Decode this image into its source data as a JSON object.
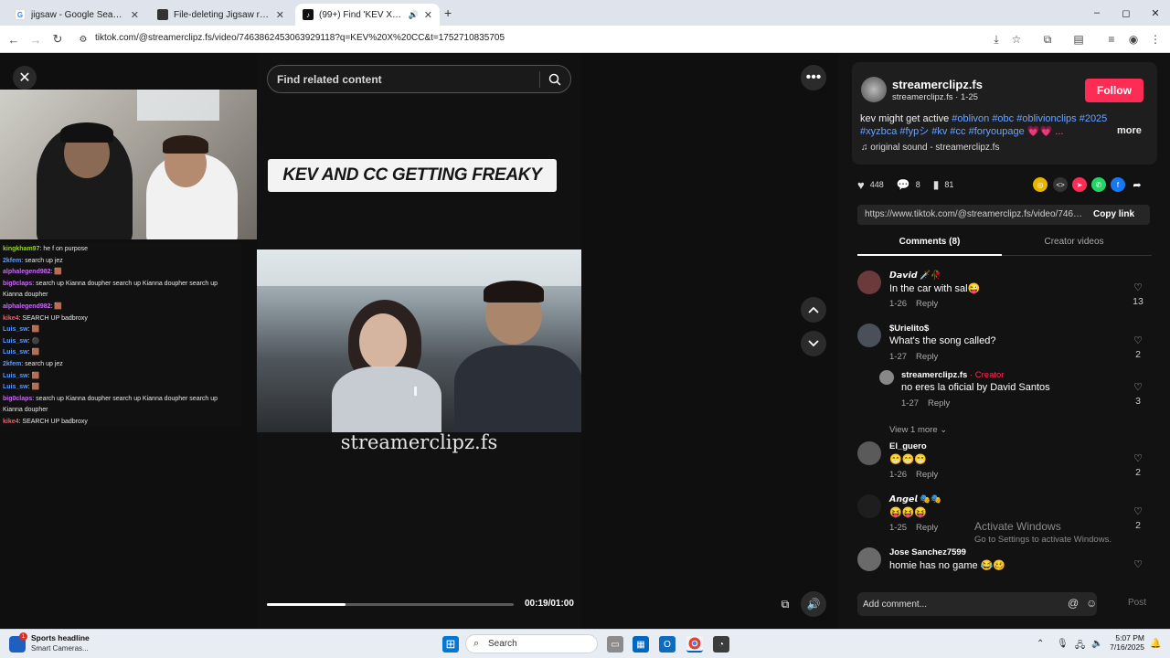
{
  "browser": {
    "tabs": [
      {
        "title": "jigsaw - Google Search",
        "favicon_color": "#4285f4"
      },
      {
        "title": "File-deleting Jigsaw ransomwa",
        "favicon_color": "#333333"
      },
      {
        "title": "(99+) Find 'KEV X CC' on Tik",
        "favicon_color": "#111111"
      }
    ],
    "new_tab": "+",
    "url": "tiktok.com/@streamerclipz.fs/video/7463862453063929118?q=KEV%20X%20CC&t=1752710835705",
    "win": {
      "minimize": "–",
      "maximize": "◻",
      "close": "✕"
    }
  },
  "player": {
    "search_placeholder": "Find related content",
    "caption_banner": "KEV AND CC GETTING FREAKY",
    "watermark": "streamerclipz.fs",
    "time": "00:19/01:00",
    "progress": 0.32,
    "chat": [
      {
        "user": "kingkham97",
        "color": "#9acd32",
        "msg": ": he f on purpose"
      },
      {
        "user": "2kfem",
        "color": "#5b9bff",
        "msg": ": search up jez"
      },
      {
        "user": "alphalegend982",
        "color": "#c56cf0",
        "msg": ": 🟫"
      },
      {
        "user": "big0claps",
        "color": "#c56cf0",
        "msg": ": search up Kianna doupher search up Kianna doupher search up"
      },
      {
        "user": "",
        "color": "#e8e8e8",
        "msg": "Kianna doupher"
      },
      {
        "user": "alphalegend982",
        "color": "#c56cf0",
        "msg": ": 🟫"
      },
      {
        "user": "kike4",
        "color": "#ff5566",
        "msg": ": SEARCH UP badbroxy"
      },
      {
        "user": "Luis_sw",
        "color": "#5b9bff",
        "msg": ": 🟫"
      },
      {
        "user": "Luis_sw",
        "color": "#5b9bff",
        "msg": ": ⚫"
      },
      {
        "user": "Luis_sw",
        "color": "#5b9bff",
        "msg": ": 🟫"
      },
      {
        "user": "2kfem",
        "color": "#5b9bff",
        "msg": ": search up jez"
      },
      {
        "user": "Luis_sw",
        "color": "#5b9bff",
        "msg": ": 🟫"
      },
      {
        "user": "Luis_sw",
        "color": "#5b9bff",
        "msg": ": 🟫"
      },
      {
        "user": "big0claps",
        "color": "#c56cf0",
        "msg": ": search up Kianna doupher search up Kianna doupher search up"
      },
      {
        "user": "",
        "color": "#e8e8e8",
        "msg": "Kianna doupher"
      },
      {
        "user": "kike4",
        "color": "#ff5566",
        "msg": ": SEARCH UP badbroxy"
      }
    ]
  },
  "side": {
    "author_name": "streamerclipz.fs",
    "author_sub": "streamerclipz.fs · 1-25",
    "follow": "Follow",
    "desc_text": "kev might get active ",
    "desc_tags_1": "#oblivon #obc #oblivionclips #2025",
    "desc_tags_2": "#xyzbca #fypシ #kv #cc #foryoupage",
    "desc_tail": "💗💗 ...",
    "more": "more",
    "sound": "♫  original sound - streamerclipz.fs",
    "likes": "448",
    "comments_count": "8",
    "saves": "81",
    "link": "https://www.tiktok.com/@streamerclipz.fs/video/7463...",
    "copy_link": "Copy link",
    "tab_comments": "Comments (8)",
    "tab_creator": "Creator videos",
    "view_more": "View 1 more ⌄",
    "comment_placeholder": "Add comment...",
    "post": "Post"
  },
  "comments": [
    {
      "name": "𝘿𝙖𝙫𝙞𝙙 🗡️🥀",
      "text": "In the car with sal😜",
      "date": "1-26",
      "reply": "Reply",
      "likes": "13"
    },
    {
      "name": "$Urielito$",
      "text": "What's the song called?",
      "date": "1-27",
      "reply": "Reply",
      "likes": "2"
    },
    {
      "name": "streamerclipz.fs",
      "creator": " · Creator",
      "text": "no eres la oficial by David Santos",
      "date": "1-27",
      "reply": "Reply",
      "likes": "3"
    },
    {
      "name": "El_guero",
      "text": "😁😁😁",
      "date": "1-26",
      "reply": "Reply",
      "likes": "2"
    },
    {
      "name": "𝘼𝙣𝙜𝙚𝙡 🎭🎭",
      "text": "😝😝😝",
      "date": "1-25",
      "reply": "Reply",
      "likes": "2"
    },
    {
      "name": "Jose Sanchez7599",
      "text": "homie has no game 😂🥴",
      "date": "",
      "reply": "",
      "likes": ""
    }
  ],
  "overlay": {
    "activate_title": "Activate Windows",
    "activate_sub": "Go to Settings to activate Windows."
  },
  "taskbar": {
    "news_title": "Sports headline",
    "news_sub": "Smart Cameras...",
    "news_badge": "1",
    "search": "Search",
    "time": "5:07 PM",
    "date": "7/16/2025"
  }
}
